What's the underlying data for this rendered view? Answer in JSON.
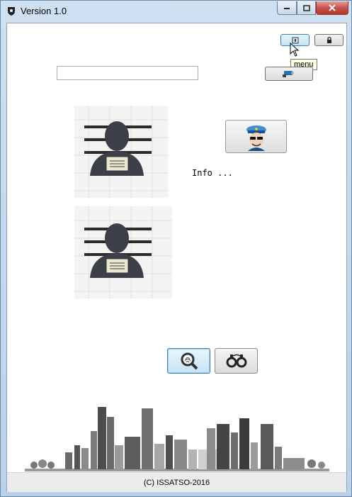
{
  "window": {
    "title": "Version 1.0"
  },
  "toolbar": {
    "tooltip": "menu"
  },
  "search": {
    "value": "",
    "placeholder": ""
  },
  "info": {
    "text": "Info ..."
  },
  "footer": {
    "text": "(C) ISSATSO-2016"
  },
  "icons": {
    "app": "shield-icon",
    "menu": "menu-icon",
    "lock": "lock-icon",
    "camera": "camera-icon",
    "police": "police-officer-icon",
    "search": "magnifier-fingerprint-icon",
    "handcuffs": "handcuffs-icon"
  },
  "colors": {
    "accent": "#3c7fb1",
    "close": "#c75050"
  }
}
